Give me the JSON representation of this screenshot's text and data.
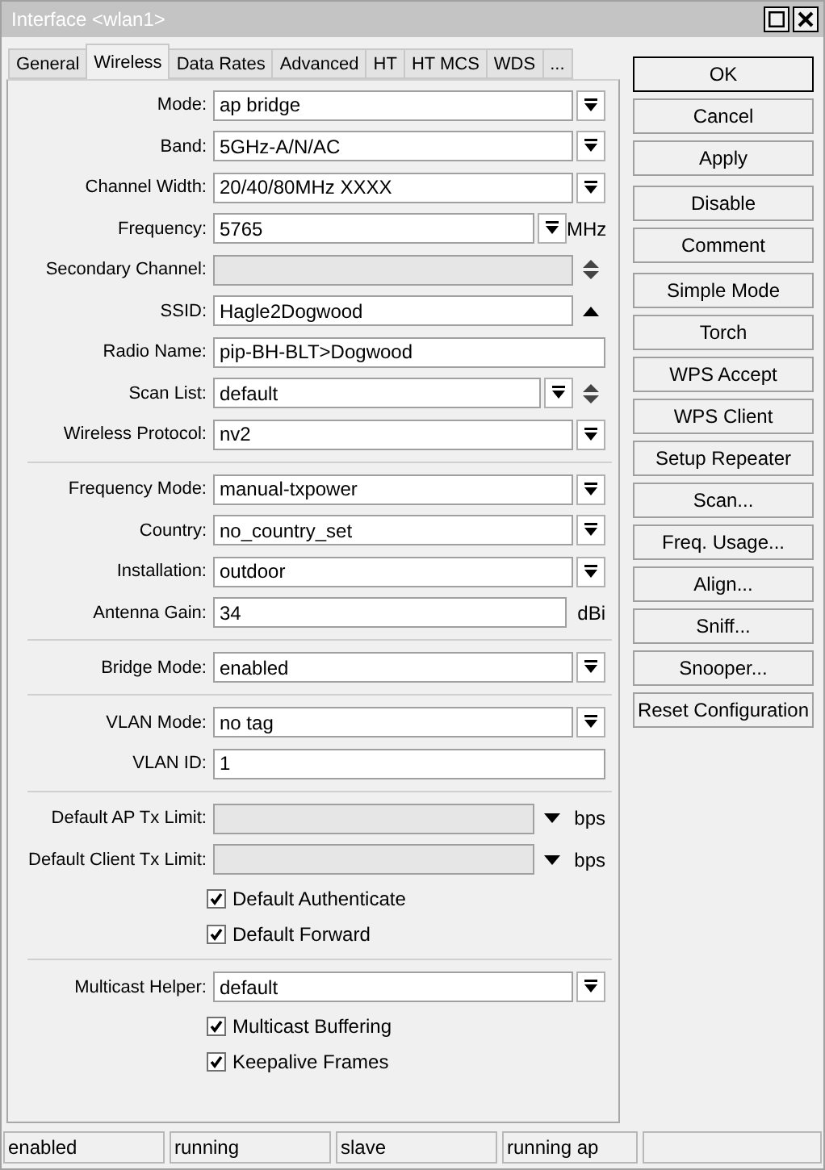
{
  "window": {
    "title": "Interface <wlan1>"
  },
  "tabs": [
    {
      "label": "General",
      "selected": false
    },
    {
      "label": "Wireless",
      "selected": true
    },
    {
      "label": "Data Rates",
      "selected": false
    },
    {
      "label": "Advanced",
      "selected": false
    },
    {
      "label": "HT",
      "selected": false
    },
    {
      "label": "HT MCS",
      "selected": false
    },
    {
      "label": "WDS",
      "selected": false
    },
    {
      "label": "...",
      "selected": false
    }
  ],
  "form": [
    {
      "kind": "dropdown",
      "label": "Mode:",
      "value": "ap bridge"
    },
    {
      "kind": "dropdown",
      "label": "Band:",
      "value": "5GHz-A/N/AC"
    },
    {
      "kind": "dropdown",
      "label": "Channel Width:",
      "value": "20/40/80MHz XXXX"
    },
    {
      "kind": "dropdown",
      "label": "Frequency:",
      "value": "5765",
      "unit": "MHz"
    },
    {
      "kind": "text",
      "label": "Secondary Channel:",
      "disabled": true,
      "extra": {
        "kind": "updown"
      }
    },
    {
      "kind": "text",
      "label": "SSID:",
      "value": "Hagle2Dogwood",
      "extra": {
        "kind": "up"
      }
    },
    {
      "kind": "text",
      "label": "Radio Name:",
      "value": "pip-BH-BLT>Dogwood"
    },
    {
      "kind": "dropdown",
      "label": "Scan List:",
      "value": "default",
      "extra": {
        "kind": "updown"
      }
    },
    {
      "kind": "dropdown",
      "label": "Wireless Protocol:",
      "value": "nv2"
    },
    {
      "kind": "separator"
    },
    {
      "kind": "dropdown",
      "label": "Frequency Mode:",
      "value": "manual-txpower"
    },
    {
      "kind": "dropdown",
      "label": "Country:",
      "value": "no_country_set"
    },
    {
      "kind": "dropdown",
      "label": "Installation:",
      "value": "outdoor"
    },
    {
      "kind": "text",
      "label": "Antenna Gain:",
      "value": "34",
      "unit": "dBi"
    },
    {
      "kind": "separator"
    },
    {
      "kind": "dropdown",
      "label": "Bridge Mode:",
      "value": "enabled"
    },
    {
      "kind": "separator"
    },
    {
      "kind": "dropdown",
      "label": "VLAN Mode:",
      "value": "no tag"
    },
    {
      "kind": "text",
      "label": "VLAN ID:",
      "value": "1"
    },
    {
      "kind": "separator"
    },
    {
      "kind": "text",
      "label": "Default AP Tx Limit:",
      "disabled": true,
      "extra": {
        "kind": "down"
      },
      "unit": "bps"
    },
    {
      "kind": "text",
      "label": "Default Client Tx Limit:",
      "disabled": true,
      "extra": {
        "kind": "down"
      },
      "unit": "bps"
    },
    {
      "kind": "checkbox",
      "label": "Default Authenticate",
      "checked": true
    },
    {
      "kind": "checkbox",
      "label": "Default Forward",
      "checked": true
    },
    {
      "kind": "separator"
    },
    {
      "kind": "dropdown",
      "label": "Multicast Helper:",
      "value": "default"
    },
    {
      "kind": "checkbox",
      "label": "Multicast Buffering",
      "checked": true
    },
    {
      "kind": "checkbox",
      "label": "Keepalive Frames",
      "checked": true
    }
  ],
  "button_groups": [
    [
      {
        "label": "OK",
        "default": true
      },
      {
        "label": "Cancel",
        "default": false
      },
      {
        "label": "Apply",
        "default": false
      }
    ],
    [
      {
        "label": "Disable",
        "default": false
      },
      {
        "label": "Comment",
        "default": false
      }
    ],
    [
      {
        "label": "Simple Mode",
        "default": false
      },
      {
        "label": "Torch",
        "default": false
      },
      {
        "label": "WPS Accept",
        "default": false
      },
      {
        "label": "WPS Client",
        "default": false
      },
      {
        "label": "Setup Repeater",
        "default": false
      },
      {
        "label": "Scan...",
        "default": false
      },
      {
        "label": "Freq. Usage...",
        "default": false
      },
      {
        "label": "Align...",
        "default": false
      },
      {
        "label": "Sniff...",
        "default": false
      },
      {
        "label": "Snooper...",
        "default": false
      },
      {
        "label": "Reset Configuration",
        "default": false
      }
    ]
  ],
  "status_bar": [
    "enabled",
    "running",
    "slave",
    "running ap"
  ]
}
